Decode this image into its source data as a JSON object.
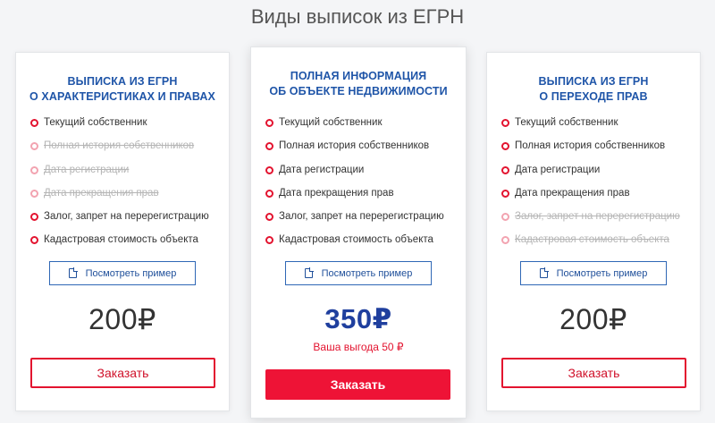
{
  "page": {
    "title": "Виды выписок из ЕГРН"
  },
  "colors": {
    "accent": "#e3132f",
    "title_blue": "#1f55a8",
    "price_blue": "#1f3f9e"
  },
  "cards": [
    {
      "title_line1": "ВЫПИСКА ИЗ ЕГРН",
      "title_line2": "О ХАРАКТЕРИСТИКАХ И ПРАВАХ",
      "features": [
        {
          "label": "Текущий собственник",
          "included": true
        },
        {
          "label": "Полная история собственников",
          "included": false
        },
        {
          "label": "Дата регистрации",
          "included": false
        },
        {
          "label": "Дата прекращения прав",
          "included": false
        },
        {
          "label": "Залог, запрет на перерегистрацию",
          "included": true
        },
        {
          "label": "Кадастровая стоимость объекта",
          "included": true
        }
      ],
      "sample_label": "Посмотреть пример",
      "sample_icon": "document-icon",
      "price": "200₽",
      "order_label": "Заказать"
    },
    {
      "title_line1": "ПОЛНАЯ ИНФОРМАЦИЯ",
      "title_line2": "ОБ ОБЪЕКТЕ НЕДВИЖИМОСТИ",
      "features": [
        {
          "label": "Текущий собственник",
          "included": true
        },
        {
          "label": "Полная история собственников",
          "included": true
        },
        {
          "label": "Дата регистрации",
          "included": true
        },
        {
          "label": "Дата прекращения прав",
          "included": true
        },
        {
          "label": "Залог, запрет на перерегистрацию",
          "included": true
        },
        {
          "label": "Кадастровая стоимость объекта",
          "included": true
        }
      ],
      "sample_label": "Посмотреть пример",
      "sample_icon": "document-icon",
      "price": "350₽",
      "benefit": "Ваша выгода 50 ₽",
      "order_label": "Заказать"
    },
    {
      "title_line1": "ВЫПИСКА ИЗ ЕГРН",
      "title_line2": "О ПЕРЕХОДЕ ПРАВ",
      "features": [
        {
          "label": "Текущий собственник",
          "included": true
        },
        {
          "label": "Полная история собственников",
          "included": true
        },
        {
          "label": "Дата регистрации",
          "included": true
        },
        {
          "label": "Дата прекращения прав",
          "included": true
        },
        {
          "label": "Залог, запрет на перерегистрацию",
          "included": false
        },
        {
          "label": "Кадастровая стоимость объекта",
          "included": false
        }
      ],
      "sample_label": "Посмотреть пример",
      "sample_icon": "document-icon",
      "price": "200₽",
      "order_label": "Заказать"
    }
  ]
}
